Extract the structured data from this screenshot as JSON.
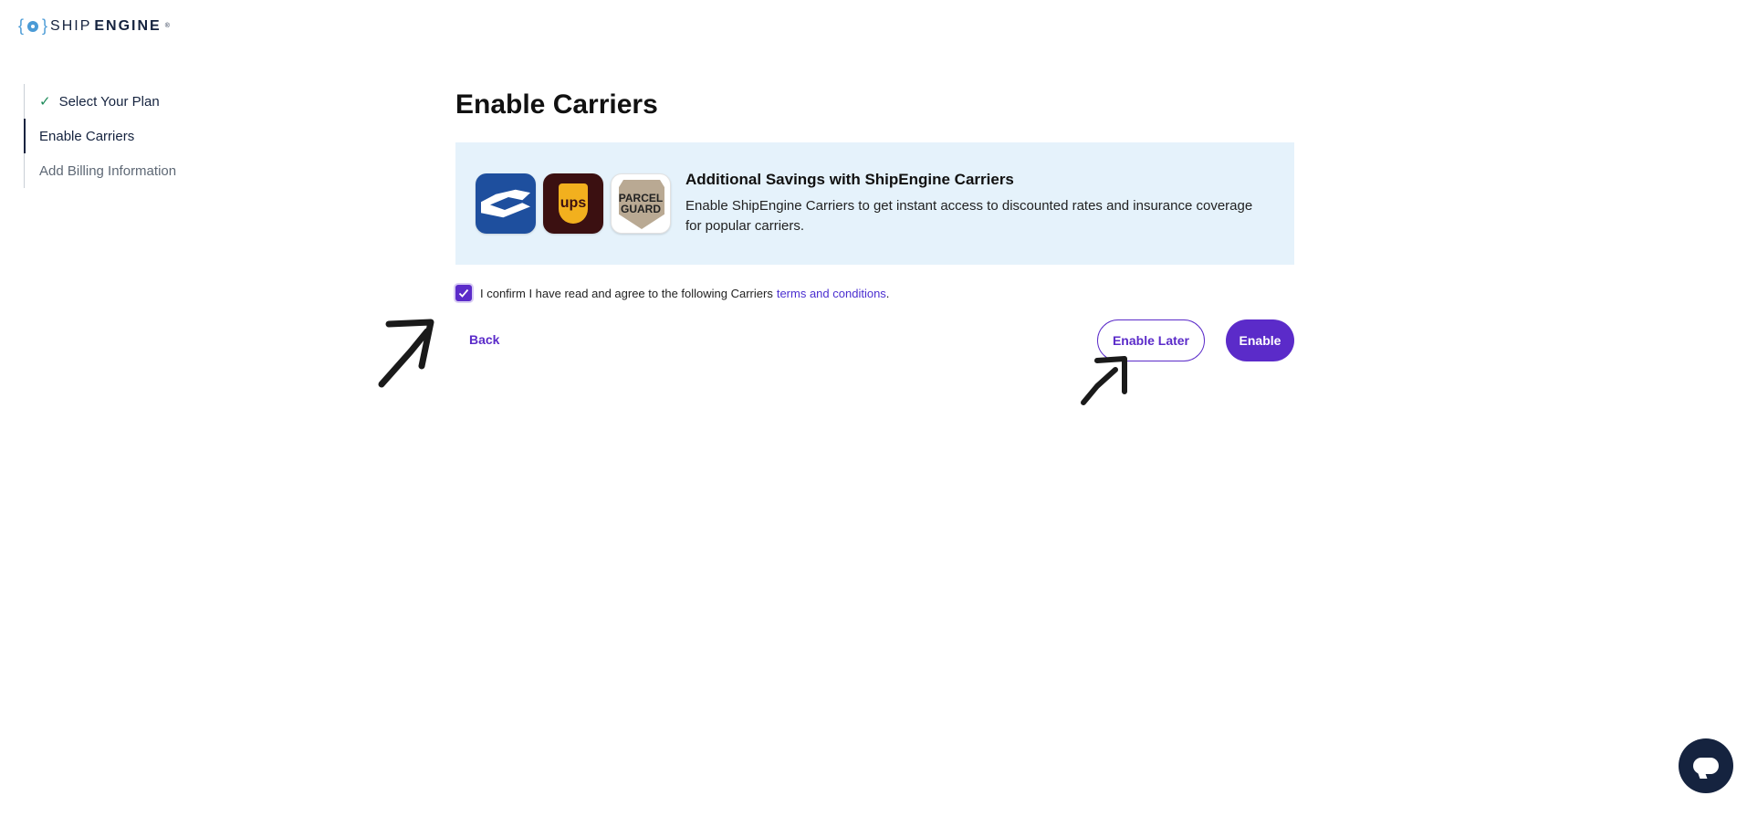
{
  "logo": {
    "ship": "SHIP",
    "engine": "ENGINE",
    "tm": "®"
  },
  "stepper": {
    "steps": [
      {
        "label": "Select Your Plan",
        "state": "done"
      },
      {
        "label": "Enable Carriers",
        "state": "active"
      },
      {
        "label": "Add Billing Information",
        "state": "pending"
      }
    ]
  },
  "main": {
    "title": "Enable Carriers",
    "banner": {
      "title": "Additional Savings with ShipEngine Carriers",
      "description": "Enable ShipEngine Carriers to get instant access to discounted rates and insurance coverage for popular carriers.",
      "carriers": [
        {
          "name": "USPS",
          "icon": "usps-logo"
        },
        {
          "name": "UPS",
          "icon": "ups-logo",
          "text": "ups"
        },
        {
          "name": "Parcel Guard",
          "icon": "parcelguard-logo",
          "text": "PARCEL GUARD"
        }
      ]
    },
    "confirm": {
      "checked": true,
      "text": "I confirm I have read and agree to the following Carriers",
      "link_text": "terms and conditions",
      "suffix": "."
    },
    "actions": {
      "back": "Back",
      "enable_later": "Enable Later",
      "enable": "Enable"
    }
  },
  "colors": {
    "primary": "#5b2bc9",
    "banner_bg": "#e5f2fb",
    "navy": "#15233f",
    "check": "#1e8b5a"
  }
}
